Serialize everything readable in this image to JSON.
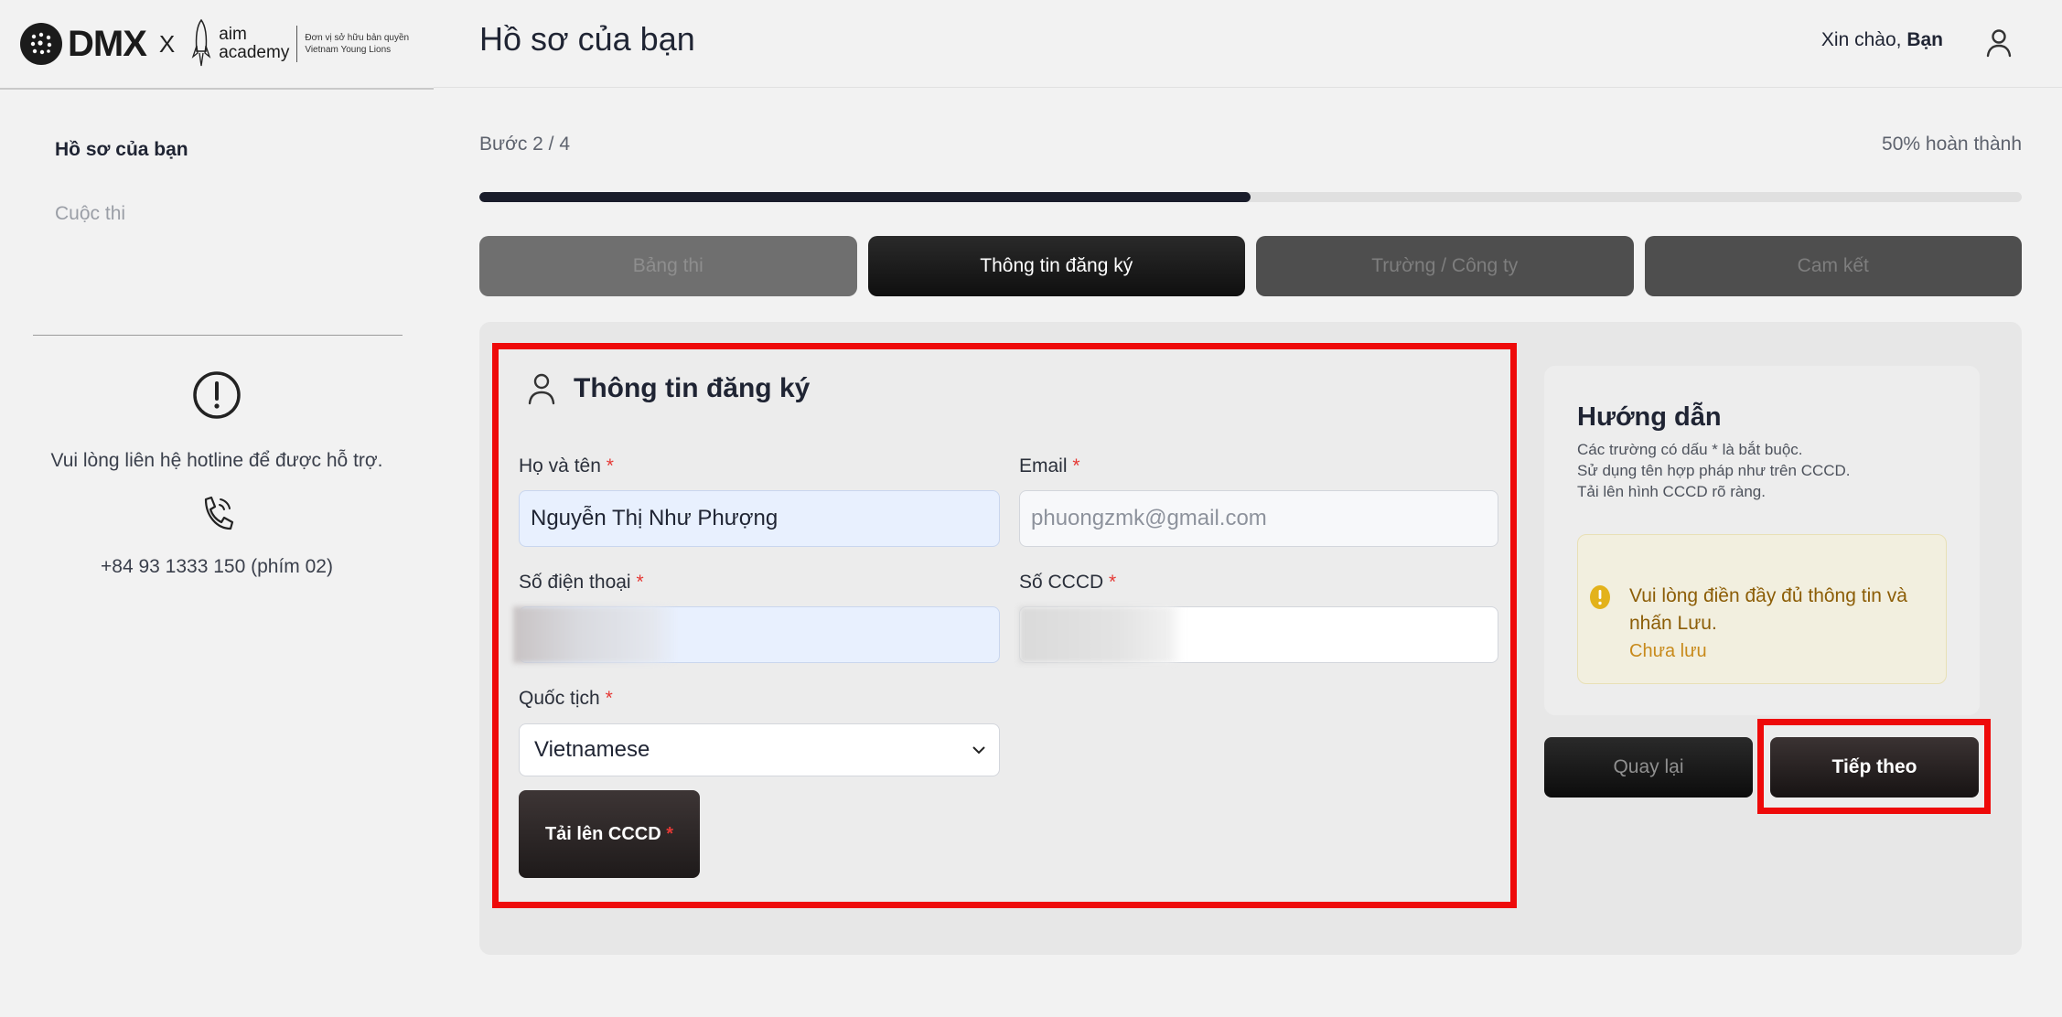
{
  "brand": {
    "dmx": "DMX",
    "x": "X",
    "aim_line1": "aim",
    "aim_line2": "academy",
    "aim_sub1": "Đơn vị sở hữu bản quyền",
    "aim_sub2": "Vietnam Young Lions"
  },
  "sidebar": {
    "items": [
      {
        "label": "Hồ sơ của bạn",
        "active": true
      },
      {
        "label": "Cuộc thi",
        "active": false
      }
    ],
    "support_text": "Vui lòng liên hệ hotline để được hỗ trợ.",
    "hotline": "+84 93 1333 150 (phím 02)"
  },
  "header": {
    "title": "Hồ sơ của bạn",
    "greeting_prefix": "Xin chào,",
    "greeting_name": "Bạn"
  },
  "progress": {
    "step_label": "Bước 2 / 4",
    "complete_label": "50% hoàn thành",
    "percent": 50
  },
  "tabs": [
    {
      "label": "Bảng thi",
      "state": "done"
    },
    {
      "label": "Thông tin đăng ký",
      "state": "current"
    },
    {
      "label": "Trường / Công ty",
      "state": "todo"
    },
    {
      "label": "Cam kết",
      "state": "todo"
    }
  ],
  "form": {
    "title": "Thông tin đăng ký",
    "required_mark": "*",
    "full_name": {
      "label": "Họ và tên",
      "value": "Nguyễn Thị Như Phượng"
    },
    "email": {
      "label": "Email",
      "value": "phuongzmk@gmail.com"
    },
    "phone": {
      "label": "Số điện thoại",
      "value": ""
    },
    "cccd": {
      "label": "Số CCCD",
      "value": ""
    },
    "nationality": {
      "label": "Quốc tịch",
      "value": "Vietnamese"
    },
    "upload_label": "Tải lên CCCD"
  },
  "guide": {
    "title": "Hướng dẫn",
    "lines": [
      "Các trường có dấu * là bắt buộc.",
      "Sử dụng tên hợp pháp như trên CCCD.",
      "Tải lên hình CCCD rõ ràng."
    ],
    "warning": "Vui lòng điền đầy đủ thông tin và nhấn Lưu.",
    "status": "Chưa lưu"
  },
  "actions": {
    "back": "Quay lại",
    "next": "Tiếp theo"
  },
  "colors": {
    "highlight": "#ee0a0a",
    "progress": "#1a1d2b",
    "warning_text": "#8c5d06"
  }
}
